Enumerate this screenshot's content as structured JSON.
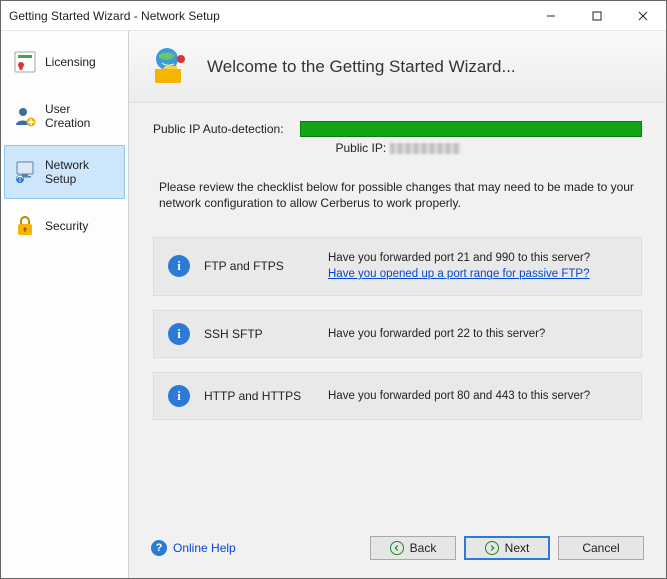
{
  "window": {
    "title": "Getting Started Wizard - Network Setup"
  },
  "sidebar": {
    "items": [
      {
        "label": "Licensing"
      },
      {
        "label": "User Creation"
      },
      {
        "label": "Network Setup"
      },
      {
        "label": "Security"
      }
    ]
  },
  "header": {
    "title": "Welcome to the Getting Started Wizard..."
  },
  "ipdetect": {
    "label": "Public IP Auto-detection:",
    "sub_prefix": "Public IP: "
  },
  "instructions": "Please review the checklist below for possible changes that may need to be made to your network configuration to allow Cerberus to work properly.",
  "checklist": [
    {
      "name": "FTP and FTPS",
      "line1": "Have you forwarded port 21 and 990 to this server?",
      "link": "Have you opened up a port range for passive FTP?"
    },
    {
      "name": "SSH SFTP",
      "line1": "Have you forwarded port 22 to this server?"
    },
    {
      "name": "HTTP and HTTPS",
      "line1": "Have you forwarded port 80 and 443 to this server?"
    }
  ],
  "footer": {
    "help": "Online Help",
    "back": "Back",
    "next": "Next",
    "cancel": "Cancel"
  }
}
